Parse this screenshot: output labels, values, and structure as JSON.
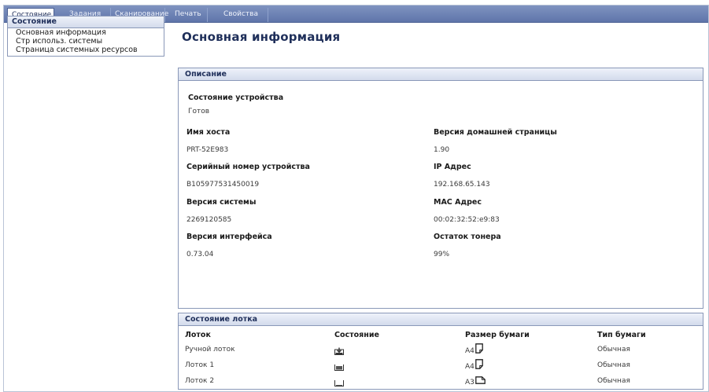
{
  "tabs": [
    {
      "label": "Состояние"
    },
    {
      "label": "Задания"
    },
    {
      "label": "Сканирование"
    },
    {
      "label": "Печать"
    },
    {
      "label": "Свойства"
    }
  ],
  "sidebar": {
    "title": "Состояние",
    "items": [
      {
        "label": "Основная информация"
      },
      {
        "label": "Стр использ. системы"
      },
      {
        "label": "Страница системных ресурсов"
      }
    ]
  },
  "main": {
    "title": "Основная информация"
  },
  "description": {
    "header": "Описание",
    "device_status_label": "Состояние устройства",
    "device_status_value": "Готов",
    "left": [
      {
        "label": "Имя хоста",
        "value": "PRT-52E983"
      },
      {
        "label": "Серийный номер устройства",
        "value": "B105977531450019"
      },
      {
        "label": "Версия системы",
        "value": "2269120585"
      },
      {
        "label": "Версия интерфейса",
        "value": "0.73.04"
      }
    ],
    "right": [
      {
        "label": "Версия домашней страницы",
        "value": "1.90"
      },
      {
        "label": "IP Адрес",
        "value": "192.168.65.143"
      },
      {
        "label": "MAC Адрес",
        "value": "00:02:32:52:e9:83"
      },
      {
        "label": "Остаток тонера",
        "value": "99%"
      }
    ]
  },
  "tray": {
    "header": "Состояние лотка",
    "columns": [
      "Лоток",
      "Состояние",
      "Размер бумаги",
      "Тип бумаги"
    ],
    "rows": [
      {
        "name": "Ручной лоток",
        "status_icon": "tray-loading-icon",
        "size": "A4",
        "orientation": "portrait",
        "type": "Обычная"
      },
      {
        "name": "Лоток 1",
        "status_icon": "tray-full-icon",
        "size": "A4",
        "orientation": "portrait",
        "type": "Обычная"
      },
      {
        "name": "Лоток 2",
        "status_icon": "tray-empty-icon",
        "size": "A3",
        "orientation": "landscape",
        "type": "Обычная"
      }
    ]
  }
}
